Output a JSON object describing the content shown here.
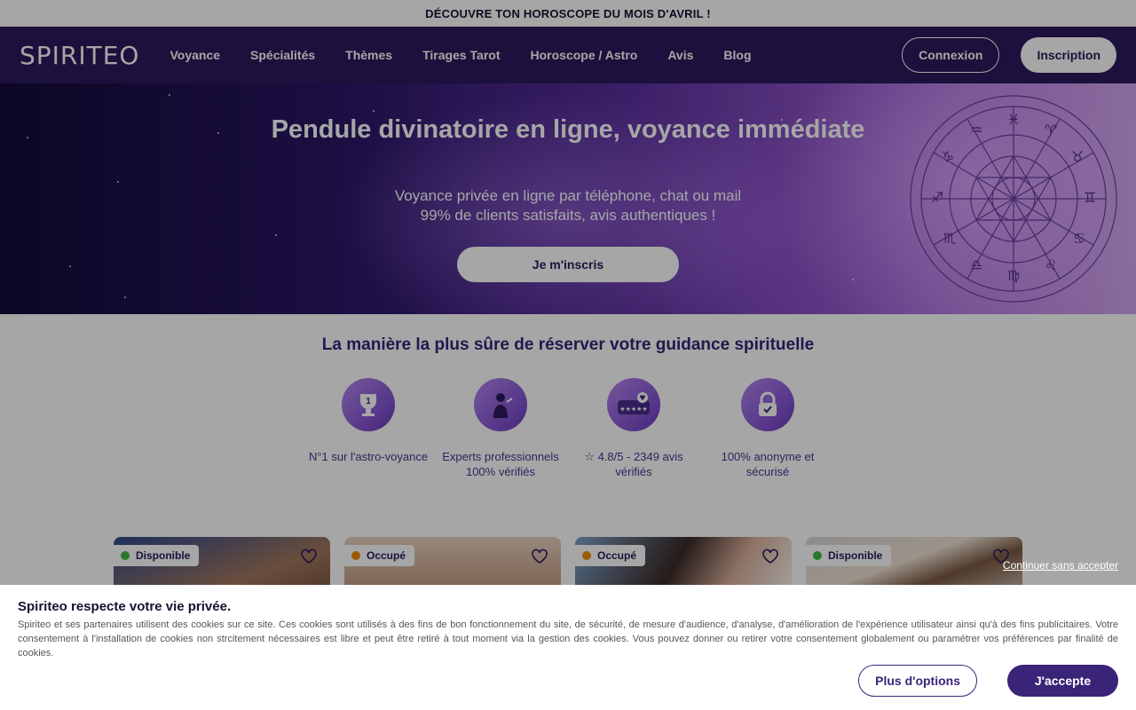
{
  "topbar": {
    "text": "DÉCOUVRE TON HOROSCOPE DU MOIS D'AVRIL !"
  },
  "navbar": {
    "logo": "SPIRITEO",
    "links": [
      "Voyance",
      "Spécialités",
      "Thèmes",
      "Tirages Tarot",
      "Horoscope / Astro",
      "Avis",
      "Blog"
    ],
    "login": "Connexion",
    "signup": "Inscription"
  },
  "hero": {
    "title": "Pendule divinatoire en ligne, voyance immédiate",
    "sub_line1": "Voyance privée en ligne par téléphone, chat ou mail",
    "sub_line2": "99% de clients satisfaits, avis authentiques !",
    "cta": "Je m'inscris"
  },
  "trust": {
    "title": "La manière la plus sûre de réserver votre guidance spirituelle",
    "features": [
      {
        "icon": "trophy-icon",
        "text": "N°1 sur l'astro-voyance"
      },
      {
        "icon": "expert-icon",
        "text": "Experts professionnels 100% vérifiés"
      },
      {
        "icon": "rating-icon",
        "text": "☆ 4.8/5 - 2349 avis vérifiés"
      },
      {
        "icon": "lock-icon",
        "text": "100% anonyme et sécurisé"
      }
    ]
  },
  "cards": [
    {
      "status": "Disponible",
      "status_color": "#3dbb3d"
    },
    {
      "status": "Occupé",
      "status_color": "#f08c00"
    },
    {
      "status": "Occupé",
      "status_color": "#f08c00"
    },
    {
      "status": "Disponible",
      "status_color": "#3dbb3d"
    }
  ],
  "cookie": {
    "skip": "Continuer sans accepter",
    "title": "Spiriteo respecte votre vie privée.",
    "body": "Spiriteo et ses partenaires utilisent des cookies sur ce site. Ces cookies sont utilisés à des fins de bon fonctionnement du site, de sécurité, de mesure d'audience, d'analyse, d'amélioration de l'expérience utilisateur ainsi qu'à des fins publicitaires. Votre consentement à l'installation de cookies non strcitement nécessaires est libre et peut être retiré à tout moment via la gestion des cookies. Vous pouvez donner ou retirer votre consentement globalement ou paramétrer vos préférences par finalité de cookies.",
    "more_options": "Plus d'options",
    "accept": "J'accepte"
  },
  "colors": {
    "brand": "#2b1a5c",
    "accent": "#3a2478",
    "available": "#3dbb3d",
    "busy": "#f08c00"
  }
}
